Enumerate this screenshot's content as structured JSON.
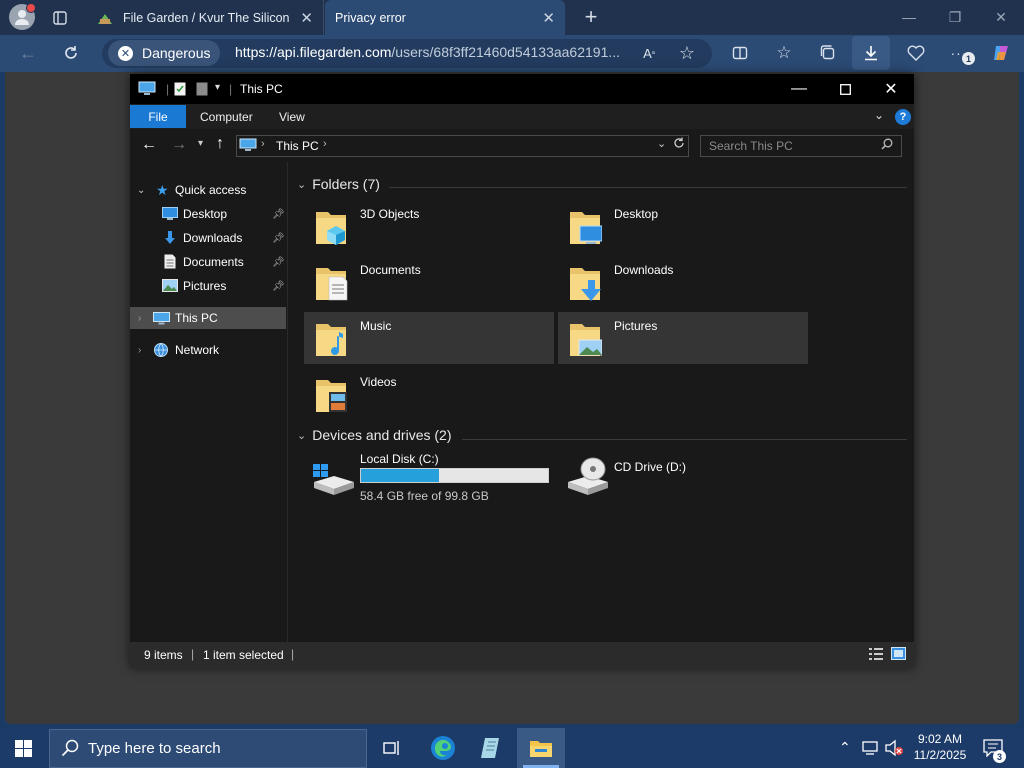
{
  "browser": {
    "tabs": [
      {
        "label": "File Garden / Kvur The Silicon"
      },
      {
        "label": "Privacy error"
      }
    ],
    "security_label": "Dangerous",
    "url_bold": "https://api.filegarden.com",
    "url_rest": "/users/68f3ff21460d54133aa62191...",
    "download_badge": "1"
  },
  "explorer": {
    "title": "This PC",
    "ribbon": {
      "file": "File",
      "tabs": [
        "Computer",
        "View"
      ]
    },
    "address": "This PC",
    "search_placeholder": "Search This PC",
    "nav": {
      "quick_access": "Quick access",
      "quick_items": [
        "Desktop",
        "Downloads",
        "Documents",
        "Pictures"
      ],
      "this_pc": "This PC",
      "network": "Network"
    },
    "folders_header": "Folders (7)",
    "folders": [
      "3D Objects",
      "Desktop",
      "Documents",
      "Downloads",
      "Music",
      "Pictures",
      "Videos"
    ],
    "drives_header": "Devices and drives (2)",
    "drives": [
      {
        "name": "Local Disk (C:)",
        "free_text": "58.4 GB free of 99.8 GB",
        "used_fraction": 0.415
      },
      {
        "name": "CD Drive (D:)"
      }
    ],
    "status": {
      "items": "9 items",
      "selected": "1 item selected"
    }
  },
  "taskbar": {
    "search_placeholder": "Type here to search",
    "time": "9:02 AM",
    "date": "11/2/2025",
    "notification_count": "3"
  }
}
